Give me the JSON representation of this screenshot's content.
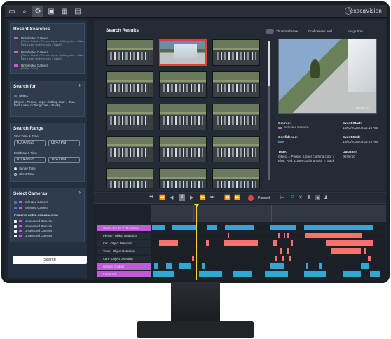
{
  "app": {
    "logo": "exacqVision"
  },
  "topbar": {
    "icons": [
      "monitor-icon",
      "search-icon",
      "gear-icon",
      "clip-icon",
      "grid-icon",
      "clipboard-icon"
    ],
    "help": "?"
  },
  "left": {
    "recent_title": "Recent Searches",
    "recent": [
      {
        "name": "Unselected Camera",
        "details": "[Filters: Object = Person, Upper clothing color = Blue, Red, Lower clothing color = Black]"
      },
      {
        "name": "Unselected Camera",
        "details": "[Filters: Object = Person, Upper clothing color = Blue, Red, Lower clothing color = Black]"
      },
      {
        "name": "Unselected Camera",
        "details": "[Filters: Color]"
      }
    ],
    "searchfor_title": "Search for",
    "object_label": "Object",
    "object_desc": "[Object = Person, Upper clothing color = Blue, Red, Lower clothing color = Black]",
    "range_title": "Search Range",
    "start_label": "Start Date & Time",
    "start_date": "01/04/2025",
    "start_time": "08:47 PM",
    "end_label": "End Date & Time",
    "end_date": "01/04/2025",
    "end_time": "10:47 PM",
    "server_time": "Server Time",
    "client_time": "Client Time",
    "cams_title": "Select Cameras",
    "selected_cams": [
      "Selected Camera",
      "Selected Camera"
    ],
    "same_location": "Cameras within same location",
    "unselected_cams": [
      "Unselected Camera",
      "Unselected Camera",
      "Unselected Camera",
      "Unselected Camera"
    ],
    "search_button": "Search"
  },
  "results": {
    "title": "Search Results",
    "thumb_view": "Thumbnail View",
    "confidence": "Confidence Level",
    "image_size": "Image Size",
    "preview_time": "00:00:10",
    "source_label": "Source:",
    "source_value": "Selected Camera",
    "event_start_label": "Event Start:",
    "event_start_value": "14/03/2025 08:12:15 AM",
    "confidence_label": "Confidence:",
    "confidence_value": "69%",
    "event_end_label": "Event End:",
    "event_end_value": "14/03/2025 08:12:25 AM",
    "type_label": "Type:",
    "type_value": "Object = Person, Upper clothing color = Blue, Red, Lower clothing color = Black",
    "duration_label": "Duration:",
    "duration_value": "00:00:10"
  },
  "timeline": {
    "paused": "Paused",
    "rows": [
      "Illustra Pro 4K PTZ Outdoor",
      "Person - Object Detection",
      "Car - Object Detection",
      "Truck - Object Detection",
      "Cart - Object Detection",
      "Garden Outdoor",
      "Camera 3"
    ]
  }
}
